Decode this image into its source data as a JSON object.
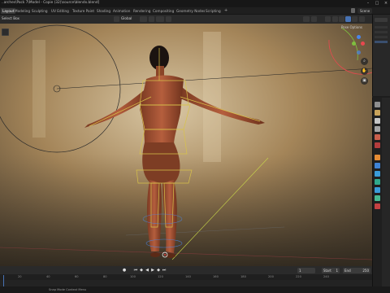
{
  "window": {
    "title": "..arches\\Pack 7\\Model - Copie (32)\\source\\blendx.blend]"
  },
  "workspaces": [
    "Layout",
    "Modeling",
    "Sculpting",
    "UV Editing",
    "Texture Paint",
    "Shading",
    "Animation",
    "Rendering",
    "Compositing",
    "Geometry Nodes",
    "Scripting"
  ],
  "menubar": {
    "scene": "Scene"
  },
  "viewport_header": {
    "select_mode": "Select Box",
    "global": "Global",
    "pose_options": "Pose Options"
  },
  "timeline": {
    "current_frame": "1",
    "start_label": "Start",
    "start": "1",
    "end_label": "End",
    "end": "250",
    "ruler": [
      "20",
      "40",
      "60",
      "80",
      "100",
      "120",
      "140",
      "160",
      "180",
      "200",
      "220",
      "240"
    ]
  },
  "status": {
    "text": "Snap Mode Context Menu"
  },
  "colors": {
    "accent": "#4772b3",
    "armature": "#d8c24a",
    "axis_x": "#e8484f",
    "axis_y": "#7fbf3f",
    "axis_z": "#4a86e8"
  }
}
